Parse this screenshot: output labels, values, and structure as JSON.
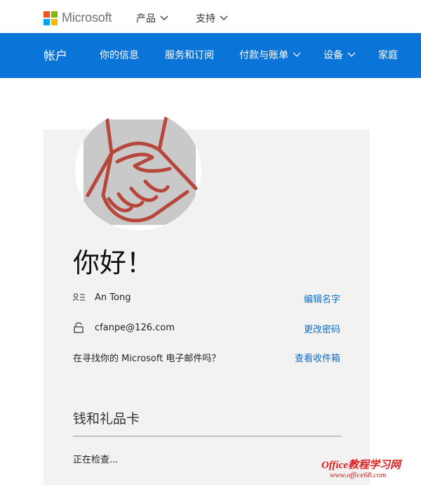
{
  "brand": {
    "name": "Microsoft"
  },
  "topbar": {
    "products": "产品",
    "support": "支持"
  },
  "nav": {
    "title": "帐户",
    "items": [
      "你的信息",
      "服务和订阅",
      "付款与账单",
      "设备",
      "家庭"
    ]
  },
  "profile": {
    "greeting": "你好！",
    "name": "An Tong",
    "edit_name": "编辑名字",
    "email": "cfanpe@126.com",
    "change_password": "更改密码",
    "outlook_question": "在寻找你的 Microsoft 电子邮件吗？",
    "view_inbox": "查看收件箱"
  },
  "wallet": {
    "title": "钱和礼品卡",
    "status": "正在检查..."
  },
  "watermark": {
    "line1": "Office教程学习网",
    "line2": "www.office68.com"
  },
  "colors": {
    "nav_blue": "#0a74d8",
    "link_blue": "#0a6ed1",
    "card_bg": "#f2f2f2",
    "avatar_red": "#b6473a"
  }
}
